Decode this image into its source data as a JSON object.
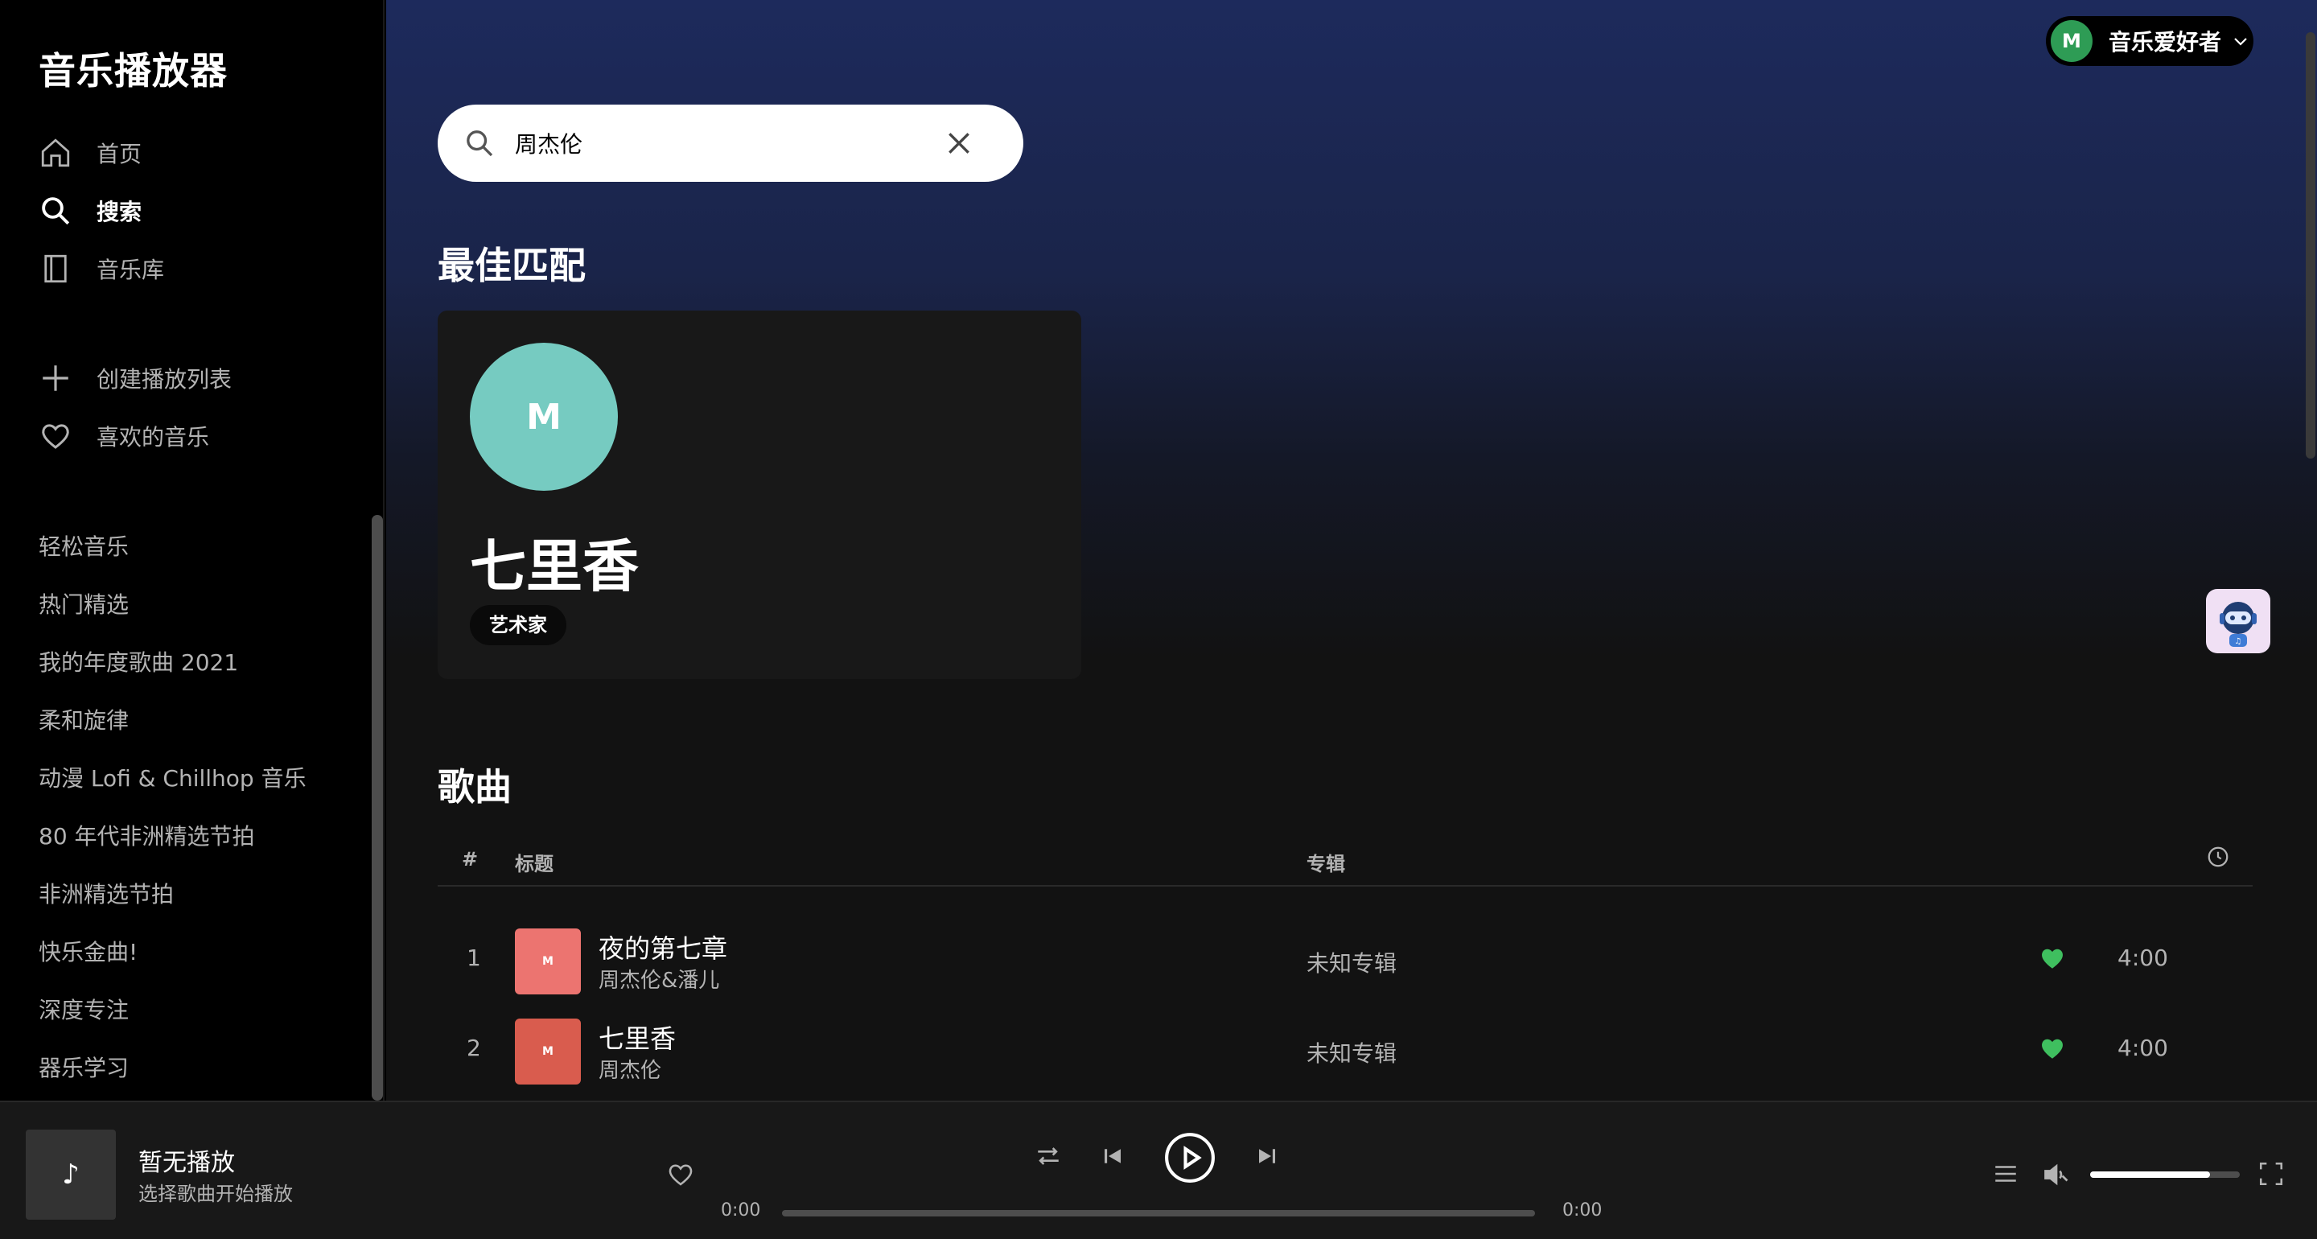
{
  "app": {
    "title": "音乐播放器"
  },
  "nav": {
    "home": "首页",
    "search": "搜索",
    "library": "音乐库",
    "create_playlist": "创建播放列表",
    "liked": "喜欢的音乐"
  },
  "playlists": [
    "轻松音乐",
    "热门精选",
    "我的年度歌曲 2021",
    "柔和旋律",
    "动漫 Lofi & Chillhop 音乐",
    "80 年代非洲精选节拍",
    "非洲精选节拍",
    "快乐金曲!",
    "深度专注",
    "器乐学习"
  ],
  "user": {
    "initial": "M",
    "name": "音乐爱好者"
  },
  "search": {
    "value": "周杰伦"
  },
  "top_result": {
    "section_title": "最佳匹配",
    "initial": "M",
    "name": "七里香",
    "badge": "艺术家"
  },
  "songs": {
    "section_title": "歌曲",
    "headers": {
      "num": "#",
      "title": "标题",
      "album": "专辑"
    },
    "rows": [
      {
        "num": "1",
        "thumb_label": "M",
        "title": "夜的第七章",
        "artist": "周杰伦&潘儿",
        "album": "未知专辑",
        "duration": "4:00",
        "color": "#ec7470"
      },
      {
        "num": "2",
        "thumb_label": "M",
        "title": "七里香",
        "artist": "周杰伦",
        "album": "未知专辑",
        "duration": "4:00",
        "color": "#d95c4e"
      }
    ]
  },
  "player": {
    "art_glyph": "♪",
    "title": "暂无播放",
    "subtitle": "选择歌曲开始播放",
    "time_current": "0:00",
    "time_total": "0:00",
    "progress": 0,
    "volume": 0.8
  },
  "colors": {
    "accent": "#1db954",
    "heart": "#3fbf5f"
  }
}
